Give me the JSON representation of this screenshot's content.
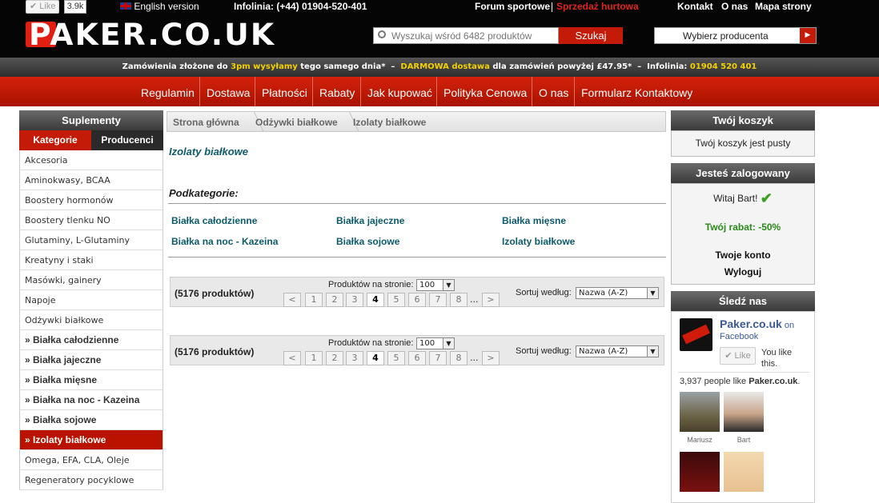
{
  "header": {
    "like_label": "Like",
    "like_count": "3.9k",
    "english_link": "English version",
    "infolinia": "Infolinia: (+44) 01904-520-401",
    "forum_link": "Forum sportowe",
    "wholesale_link": "Sprzedaż hurtowa",
    "contact_link": "Kontakt",
    "about_link": "O nas",
    "sitemap_link": "Mapa strony",
    "logo_text": "PAKER.CO.UK",
    "search_placeholder": "Wyszukaj wśród 6482 produktów",
    "search_button": "Szukaj",
    "producer_select": "Wybierz producenta"
  },
  "band": {
    "t1": "Zamówienia złożone do",
    "t2": "3pm wysyłamy",
    "t3": "tego samego dnia*",
    "t4": "DARMOWA dostawa",
    "t5": "dla zamówień powyżej £47.95*",
    "t6": "Infolinia:",
    "t7": "01904 520 401"
  },
  "nav": [
    "Regulamin",
    "Dostawa",
    "Płatności",
    "Rabaty",
    "Jak kupować",
    "Polityka Cenowa",
    "O nas",
    "Formularz Kontaktowy"
  ],
  "left": {
    "title": "Suplementy",
    "tab_categories": "Kategorie",
    "tab_producers": "Producenci",
    "items": [
      "Akcesoria",
      "Aminokwasy, BCAA",
      "Boostery hormonów",
      "Boostery tlenku NO",
      "Glutaminy, L-Glutaminy",
      "Kreatyny i staki",
      "Masówki, gainery",
      "Napoje",
      "Odżywki białkowe",
      "» Białka całodzienne",
      "» Białka jajeczne",
      "» Białka mięsne",
      "» Białka na noc - Kazeina",
      "» Białka sojowe",
      "» Izolaty białkowe",
      "Omega, EFA, CLA, Oleje",
      "Regeneratory pocyklowe"
    ]
  },
  "main": {
    "breadcrumb": [
      "Strona główna",
      "Odżywki białkowe",
      "Izolaty białkowe"
    ],
    "page_title": "Izolaty białkowe",
    "subcat_heading": "Podkategorie:",
    "subcats": [
      "Białka całodzienne",
      "Białka jajeczne",
      "Białka mięsne",
      "Białka na noc - Kazeina",
      "Białka sojowe",
      "Izolaty białkowe"
    ],
    "pager": {
      "count": "(5176 produktów)",
      "per_page_label": "Produktów na stronie:",
      "per_page_value": "100",
      "sort_label": "Sortuj według:",
      "sort_value": "Nazwa (A-Z)",
      "prev": "<",
      "next": ">",
      "pages": [
        "1",
        "2",
        "3",
        "4",
        "5",
        "6",
        "7",
        "8"
      ],
      "current": "4",
      "ellipsis": "..."
    }
  },
  "right": {
    "cart_title": "Twój koszyk",
    "cart_text": "Twój koszyk jest pusty",
    "login_title": "Jesteś zalogowany",
    "welcome": "Witaj Bart!",
    "discount": "Twój rabat: -50%",
    "account_link": "Twoje konto",
    "logout_link": "Wyloguj",
    "follow_title": "Śledź nas",
    "fb_page": "Paker.co.uk",
    "fb_on": "on",
    "fb_facebook": "Facebook",
    "fb_like": "Like",
    "fb_you_like": "You like this.",
    "fb_count": "3,937 people like",
    "fb_count_name": "Paker.co.uk",
    "friends": [
      "Mariusz",
      "Bart"
    ]
  },
  "colors": {
    "accent": "#b91300",
    "link": "#0d5a6a",
    "green": "#2a8a1a",
    "yellow": "#f4d000"
  }
}
